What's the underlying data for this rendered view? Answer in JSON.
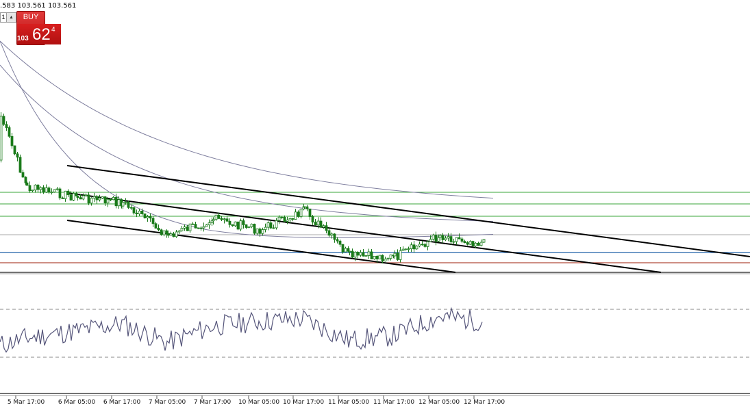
{
  "toolbar": {
    "ohlc_text": ".583 103.561 103.561",
    "lot_value": "1",
    "spin_glyph": "▲",
    "buy_label": "BUY",
    "price_small": "103",
    "price_big": "62",
    "price_sup": "4"
  },
  "chart_data": {
    "type": "line",
    "title": "",
    "x_tick_labels": [
      "5 Mar 17:00",
      "6 Mar 05:00",
      "6 Mar 17:00",
      "7 Mar 05:00",
      "7 Mar 17:00",
      "10 Mar 05:00",
      "10 Mar 17:00",
      "11 Mar 05:00",
      "11 Mar 17:00",
      "12 Mar 05:00",
      "12 Mar 17:00"
    ],
    "price_series": [
      {
        "label": "5 Mar 17:00",
        "close": 103.97
      },
      {
        "label": "6 Mar 05:00",
        "close": 103.9
      },
      {
        "label": "6 Mar 17:00",
        "close": 103.86
      },
      {
        "label": "7 Mar 05:00",
        "close": 103.62
      },
      {
        "label": "7 Mar 17:00",
        "close": 103.74
      },
      {
        "label": "10 Mar 05:00",
        "close": 103.66
      },
      {
        "label": "10 Mar 17:00",
        "close": 103.8
      },
      {
        "label": "11 Mar 05:00",
        "close": 103.47
      },
      {
        "label": "11 Mar 17:00",
        "close": 103.46
      },
      {
        "label": "12 Mar 05:00",
        "close": 103.62
      },
      {
        "label": "12 Mar 17:00",
        "close": 103.56
      }
    ],
    "oscillator_series": [
      46,
      52,
      58,
      42,
      56,
      60,
      62,
      44,
      48,
      64,
      60
    ],
    "oscillator_levels": [
      70,
      30
    ],
    "line_colors": {
      "candle": "#1a7a1a",
      "moving_average": "#7e7e9e",
      "channel": "#000000",
      "support_resistance": "#3aa63a",
      "blue_level": "#1d5fa8",
      "red_level": "#b04a3a",
      "oscillator": "#55557a"
    }
  }
}
